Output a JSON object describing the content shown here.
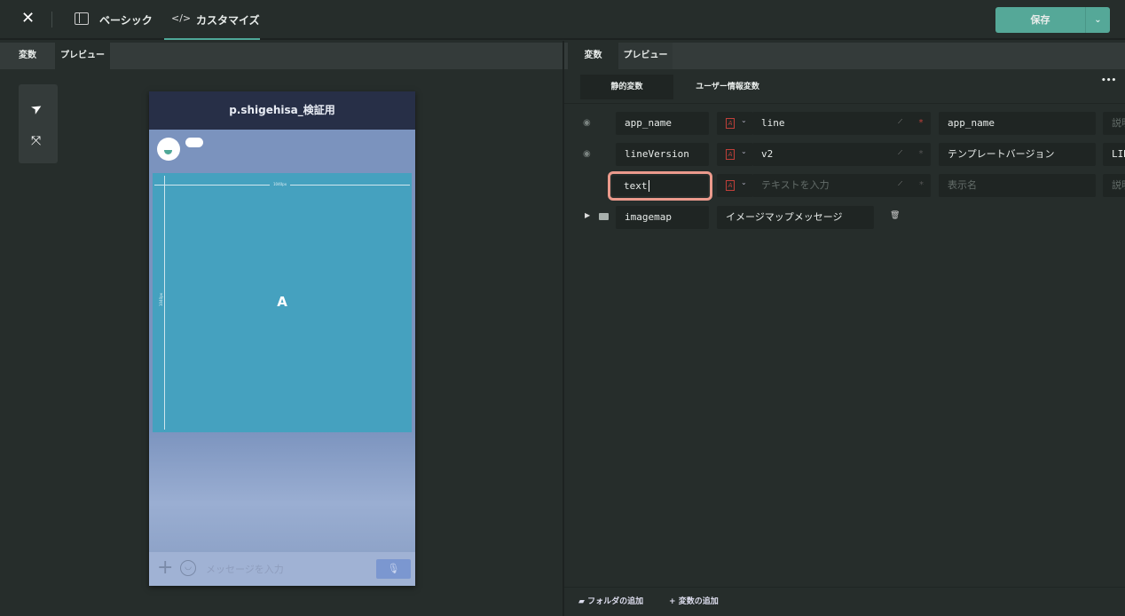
{
  "topbar": {
    "close_icon": "close-icon",
    "basic_label": "ベーシック",
    "custom_label": "カスタマイズ",
    "save_label": "保存",
    "accent": "#4fa898"
  },
  "left": {
    "tabs": [
      "変数",
      "プレビュー"
    ],
    "active_tab": "プレビュー"
  },
  "phone": {
    "title": "p.shigehisa_検証用",
    "width_label": "1040px",
    "height_label": "1040px",
    "area_label": "A",
    "input_placeholder": "メッセージを入力"
  },
  "right": {
    "tabs": [
      "変数",
      "プレビュー"
    ],
    "active_tab": "変数",
    "subtabs": [
      "静的変数",
      "ユーザー情報変数"
    ],
    "active_subtab": "静的変数",
    "more": "•••",
    "rows": [
      {
        "name": "app_name",
        "value": "line",
        "required": true,
        "display": "app_name",
        "desc": "説明"
      },
      {
        "name": "lineVersion",
        "value": "v2",
        "required": false,
        "display": "テンプレートバージョン",
        "desc": "LINE"
      },
      {
        "name": "text",
        "value_placeholder": "テキストを入力",
        "display_placeholder": "表示名",
        "desc_placeholder": "説明"
      }
    ],
    "folder": {
      "name": "imagemap",
      "label": "イメージマップメッセージ"
    },
    "add_folder": "フォルダの追加",
    "add_variable": "変数の追加"
  }
}
